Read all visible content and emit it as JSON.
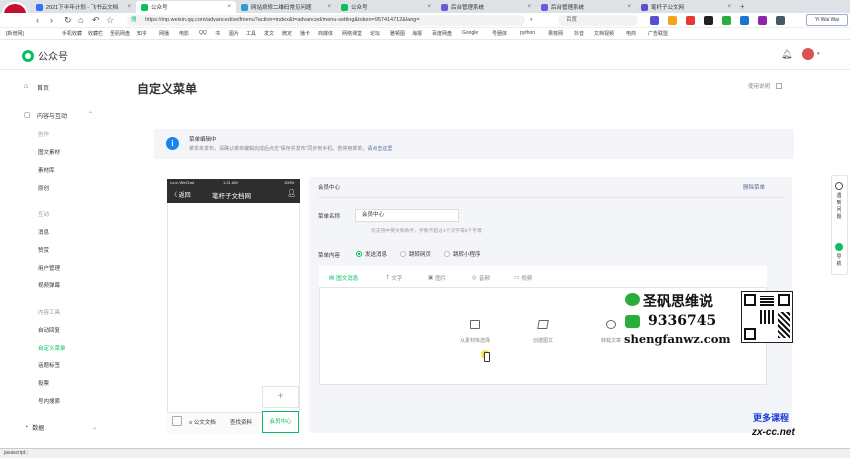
{
  "browser": {
    "tabs": [
      {
        "title": "2021下半年计划 - 飞书云文档",
        "active": false
      },
      {
        "title": "公众号",
        "active": true
      },
      {
        "title": "网站烦修二维码常见问题",
        "active": false
      },
      {
        "title": "公众号",
        "active": false
      },
      {
        "title": "后台管理系统",
        "active": false
      },
      {
        "title": "后台管理系统",
        "active": false
      },
      {
        "title": "笔杆子公文网",
        "active": false
      }
    ],
    "address_prefix": "搜",
    "address_url": "https://mp.weixin.qq.com/advanced/selfmenu?action=index&t=advanced/menu-setting&token=957414712&lang=",
    "search_engine": "百度",
    "profile_label": "Yi Wai Wai",
    "bookmarks": [
      "[新增网]",
      "手机收藏",
      "收藏栏",
      "圣矾网盘",
      "知乎",
      "网播",
      "电影",
      "QQ",
      "书",
      "图片",
      "工具",
      "发文",
      "微定",
      "播卡",
      "商媒体",
      "网络课堂",
      "论坛",
      "雅顿图",
      "海报",
      "百度网盘",
      "Google",
      "号圈体",
      "python",
      "果核网",
      "抖音",
      "文档视频",
      "电商",
      "广告联盟"
    ],
    "status_text": "javascript:;"
  },
  "app": {
    "brand": "公众号",
    "page_title": "自定义菜单",
    "help_link": "使用说明"
  },
  "sidebar": {
    "home": "首页",
    "content_group": "内容与互动",
    "sec_create": "创作",
    "create_items": [
      "图文素材",
      "素材库",
      "原创"
    ],
    "sec_interact": "互动",
    "interact_items": [
      "消息",
      "赞赏",
      "用户管理",
      "视频弹幕"
    ],
    "sec_tools": "内容工具",
    "tools_items": [
      "自动回复",
      "自定义菜单",
      "话题标签",
      "投票",
      "号内搜索"
    ],
    "data_group": "数据"
  },
  "notice": {
    "title": "菜单编辑中",
    "text": "菜单未发布，请确认菜单编辑完成后点击“保存并发布”同步到手机。若停用菜单，",
    "link": "请点击这里"
  },
  "phone": {
    "carrier": "•••••• WeChat",
    "time": "1:21 AM",
    "battery": "100%",
    "back": "〈 返回",
    "account_name": "笔杆子文档网",
    "add_symbol": "+",
    "menu_items": [
      "≡ 公文文档",
      "查找资料",
      "会员中心"
    ]
  },
  "editor": {
    "menu_title": "会员中心",
    "delete_label": "删除菜单",
    "name_label": "菜单名称",
    "name_value": "会员中心",
    "name_hint": "仅支持中英文和数字，字数不超过4个汉字或8个字母",
    "content_label": "菜单内容",
    "content_options": [
      {
        "label": "发送消息",
        "selected": true
      },
      {
        "label": "跳转网页",
        "selected": false
      },
      {
        "label": "跳转小程序",
        "selected": false
      }
    ],
    "msg_tabs": [
      {
        "label": "图文消息",
        "active": true
      },
      {
        "label": "文字",
        "active": false
      },
      {
        "label": "图片",
        "active": false
      },
      {
        "label": "音频",
        "active": false
      },
      {
        "label": "视频",
        "active": false
      }
    ],
    "msg_tab_icons": [
      "▤",
      "T",
      "▣",
      "◎",
      "▭"
    ],
    "actions": [
      "从素材库选择",
      "创建图文",
      "转载文章"
    ]
  },
  "right_panel": {
    "items": [
      "遇到问题",
      "导航"
    ]
  },
  "watermark": {
    "line1": "圣矾思维说",
    "line2": "9336745",
    "line3": "shengfanwz.com",
    "more": "更多课程",
    "site": "zx-cc.net"
  },
  "colors": {
    "brand_green": "#07c160",
    "link_blue": "#576b95",
    "notice_blue": "#1485ee"
  }
}
